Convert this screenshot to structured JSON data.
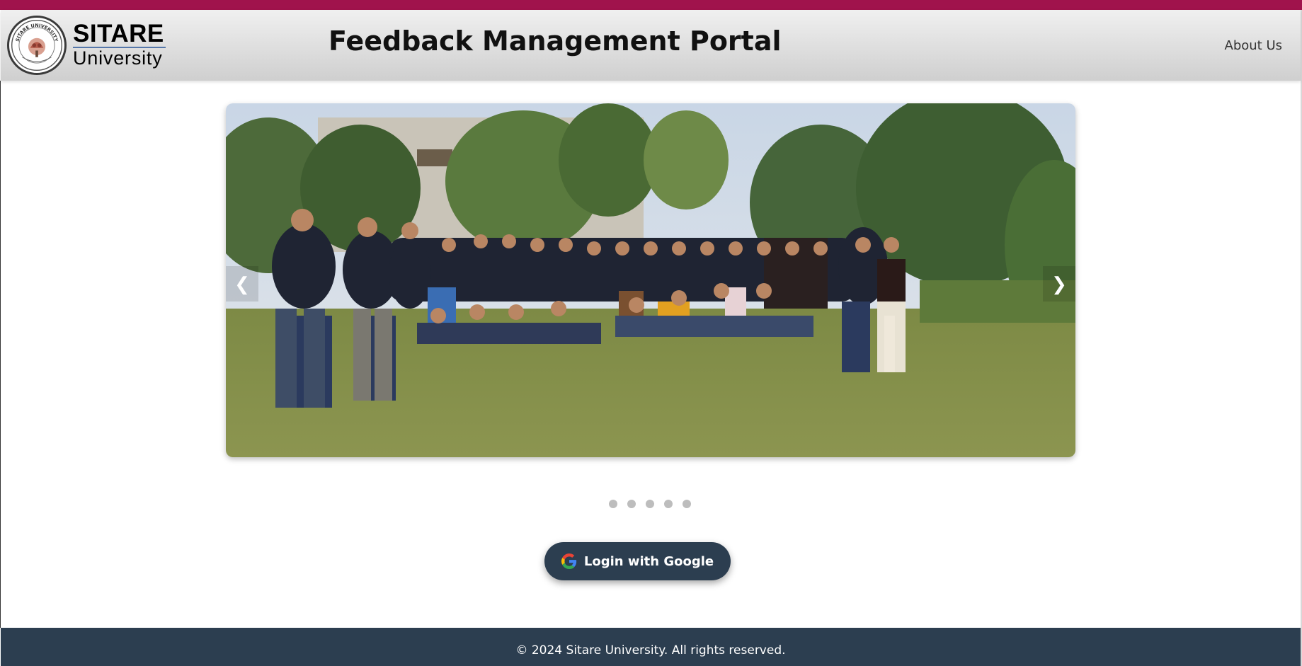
{
  "header": {
    "logo_name": "SITARE",
    "logo_sub": "University",
    "seal_text": "SITARE UNIVERSITY",
    "title": "Feedback Management Portal",
    "nav_about": "About Us"
  },
  "carousel": {
    "prev_glyph": "❮",
    "next_glyph": "❯",
    "slide_count": 5,
    "active_slide": 1
  },
  "login": {
    "label": "Login with Google",
    "icon": "google-icon"
  },
  "footer": {
    "text": "© 2024 Sitare University. All rights reserved."
  },
  "colors": {
    "top_strip": "#a0134c",
    "navy": "#2c3e50",
    "dot": "#bdbdbd"
  }
}
